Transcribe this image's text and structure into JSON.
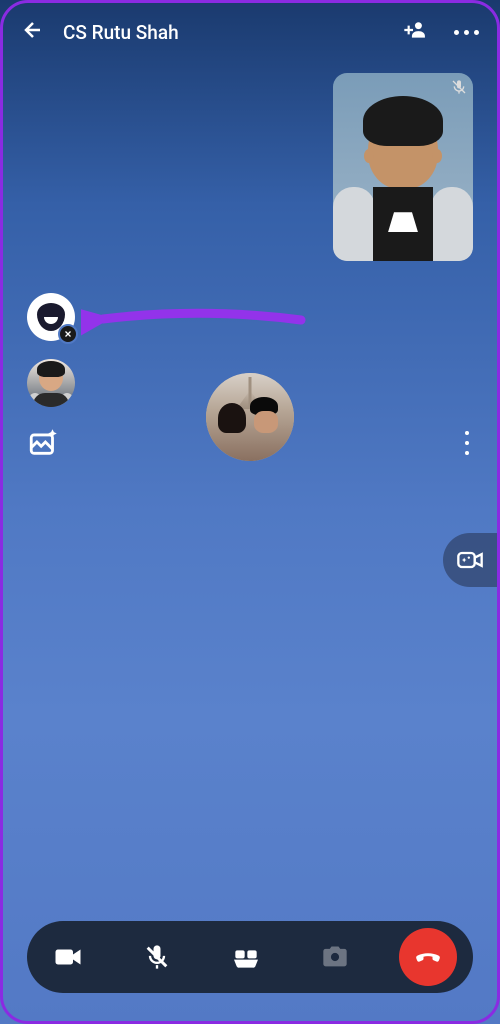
{
  "header": {
    "title": "CS Rutu Shah"
  },
  "icons": {
    "back": "back-arrow-icon",
    "add_person": "add-person-icon",
    "more": "more-menu-icon",
    "mic_muted": "mic-muted-icon",
    "avatar_toggle": "avatar-toggle-icon",
    "close": "close-icon",
    "mini_avatar": "avatar-option-icon",
    "gallery": "gallery-effects-icon",
    "vertical_more": "vertical-more-icon",
    "video_effects": "video-effects-icon",
    "camera": "camera-icon",
    "mute": "mute-icon",
    "games": "games-icon",
    "camera_switch": "camera-switch-icon",
    "end_call": "end-call-icon"
  },
  "colors": {
    "pointer": "#9333ea",
    "end_call": "#e8362e",
    "bottom_bar": "#1d2a3f"
  }
}
